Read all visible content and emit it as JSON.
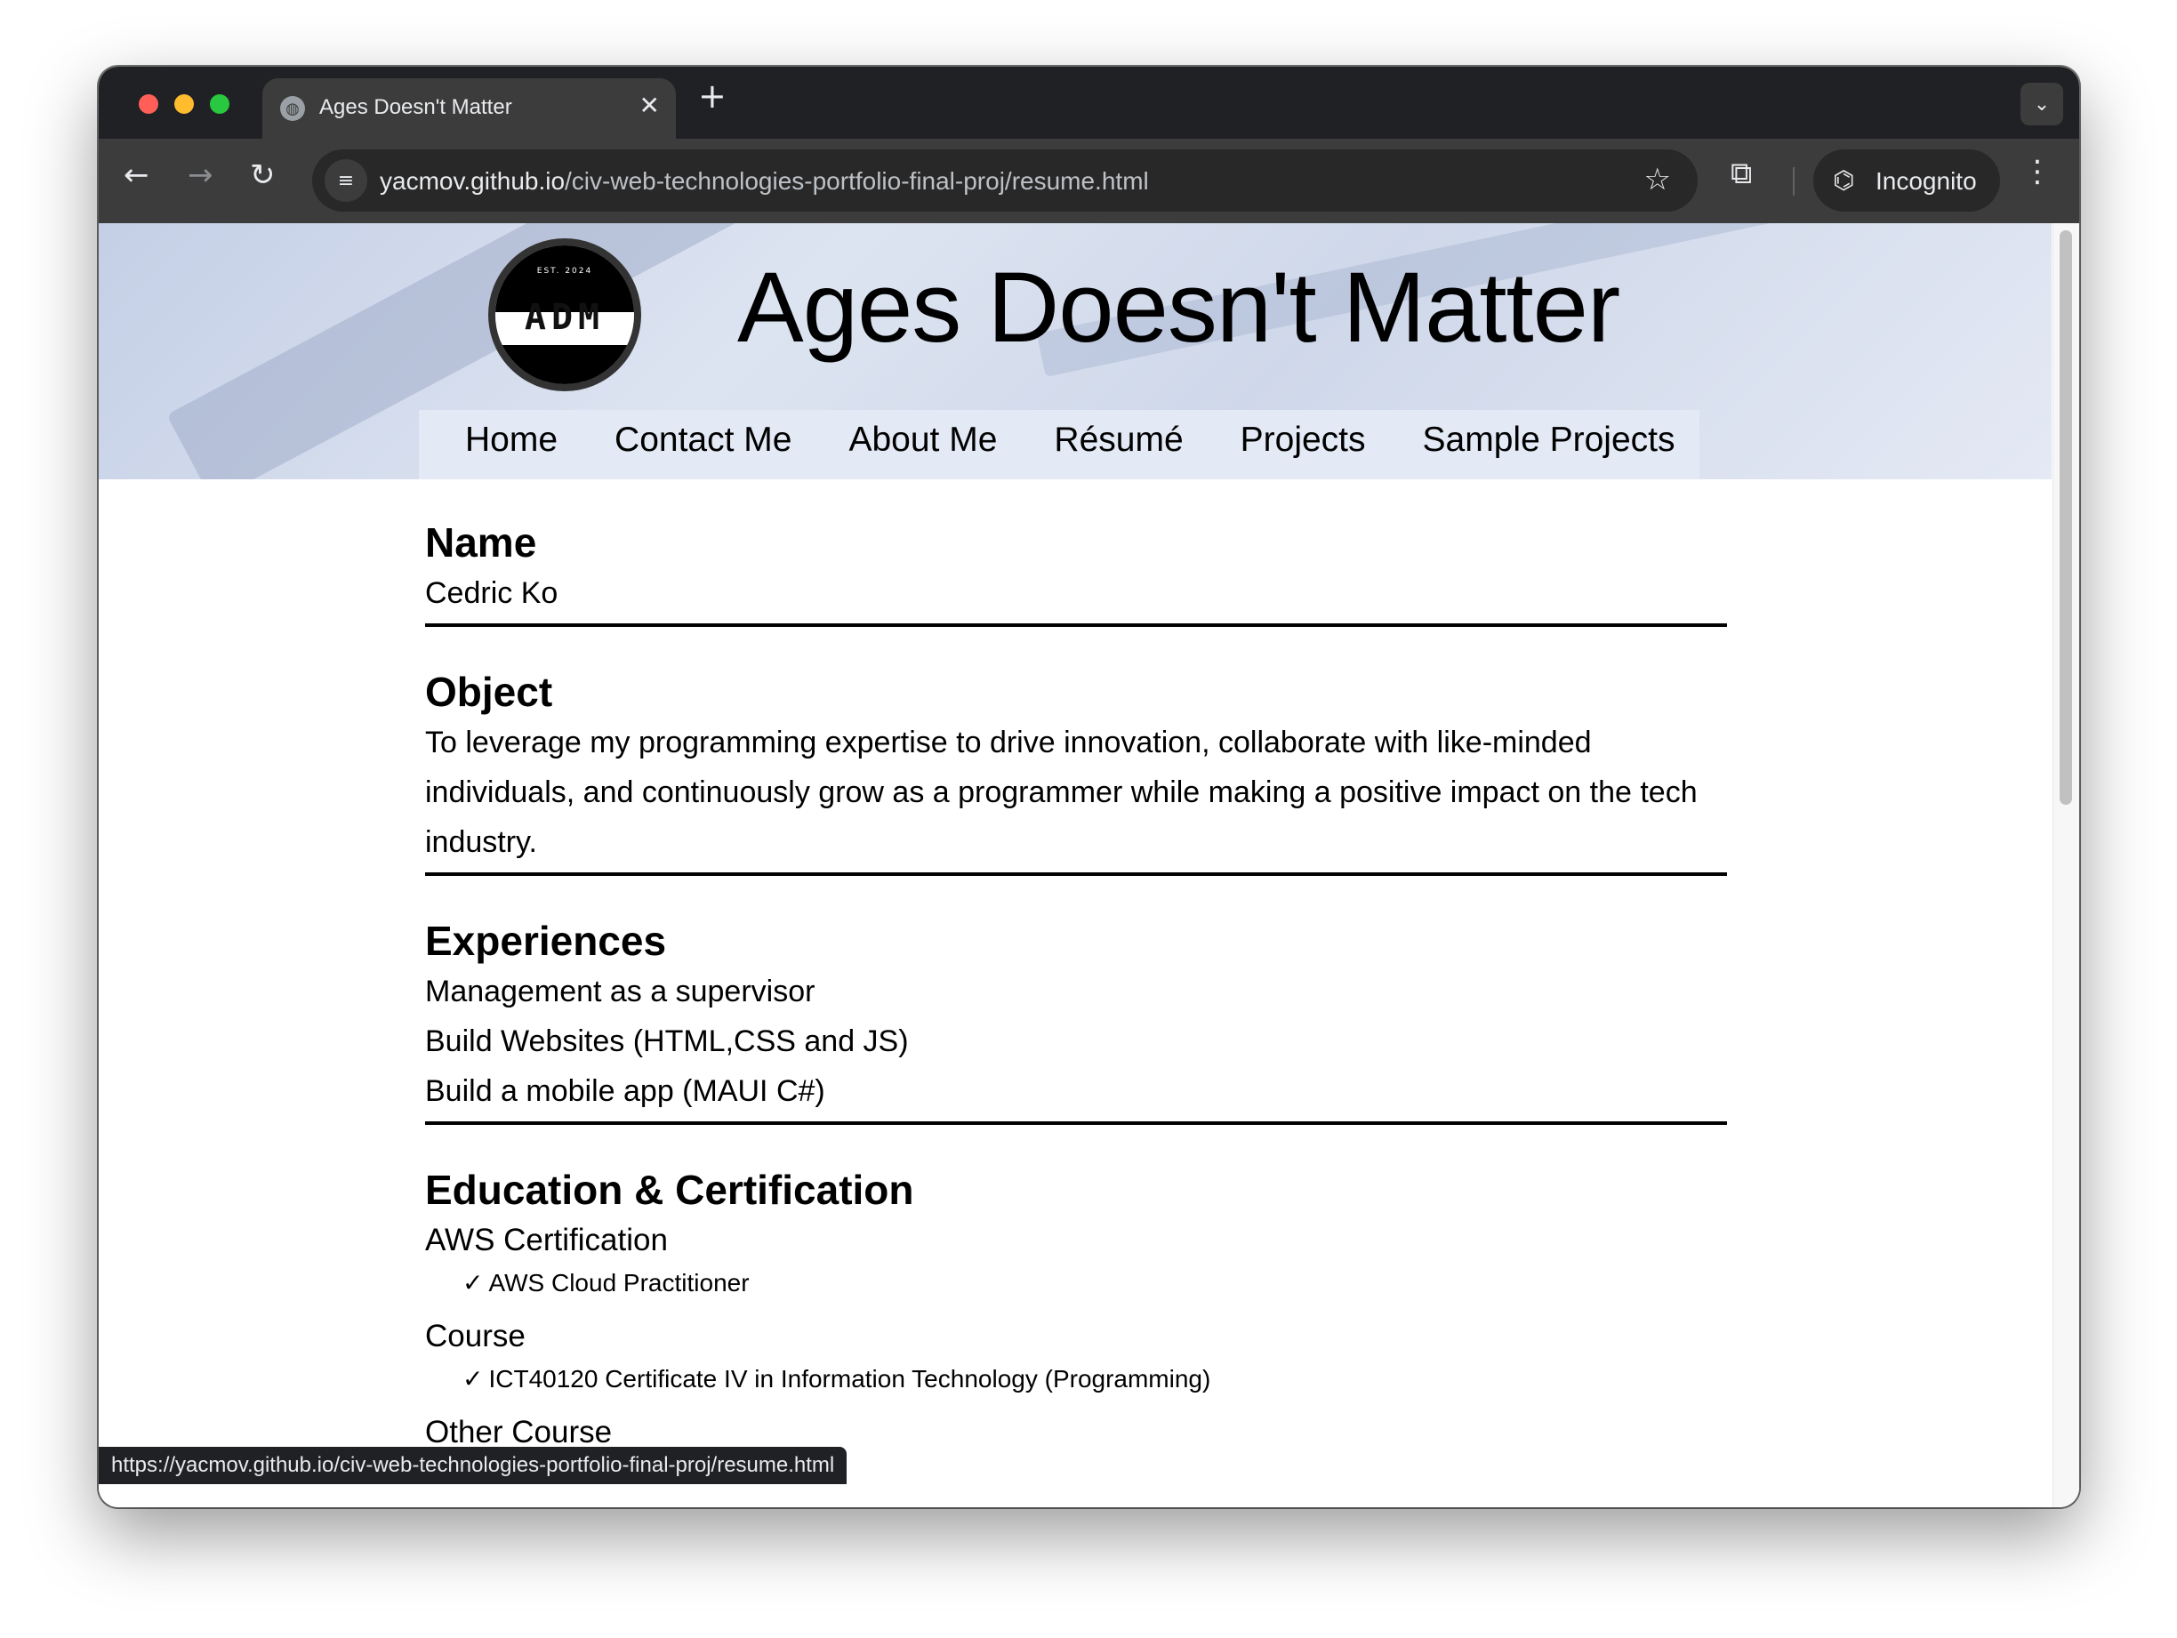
{
  "browser": {
    "tab_title": "Ages Doesn't Matter",
    "new_tab_symbol": "+",
    "url_host": "yacmov.github.io",
    "url_path": "/civ-web-technologies-portfolio-final-proj/resume.html",
    "incognito_label": "Incognito",
    "status_url": "https://yacmov.github.io/civ-web-technologies-portfolio-final-proj/resume.html"
  },
  "site": {
    "logo_est": "EST. 2024",
    "logo_text": "ADM",
    "title": "Ages Doesn't Matter",
    "nav": [
      "Home",
      "Contact Me",
      "About Me",
      "Résumé",
      "Projects",
      "Sample Projects"
    ]
  },
  "resume": {
    "name_heading": "Name",
    "name_value": "Cedric Ko",
    "object_heading": "Object",
    "object_text": "To leverage my programming expertise to drive innovation, collaborate with like-minded individuals, and continuously grow as a programmer while making a positive impact on the tech industry.",
    "experiences_heading": "Experiences",
    "experiences": [
      "Management as a supervisor",
      "Build Websites (HTML,CSS and JS)",
      "Build a mobile app (MAUI C#)"
    ],
    "education_heading": "Education & Certification",
    "education": [
      {
        "label": "AWS Certification",
        "item": "AWS Cloud Practitioner"
      },
      {
        "label": "Course",
        "item": "ICT40120 Certificate IV in Information Technology (Programming)"
      },
      {
        "label": "Other Course",
        "item": ""
      }
    ]
  },
  "icons": {
    "check": "✓",
    "close": "✕",
    "back": "←",
    "forward": "→",
    "reload": "↻",
    "star": "☆",
    "extensions": "⧉",
    "menu": "⋮",
    "chevron": "⌄",
    "incognito": "⌬",
    "site_info": "≡"
  },
  "colors": {
    "tabstrip": "#202124",
    "toolbar": "#3c3c3c",
    "hero": "#dde4f1"
  }
}
